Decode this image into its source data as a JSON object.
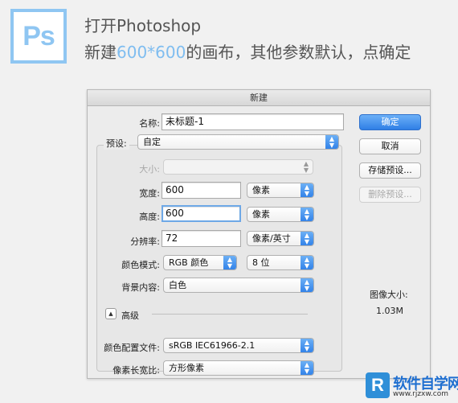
{
  "header": {
    "logo_text": "Ps",
    "line1": "打开Photoshop",
    "line2_prefix": "新建",
    "line2_highlight": "600*600",
    "line2_suffix": "的画布，其他参数默认，点确定"
  },
  "dialog": {
    "title": "新建",
    "name_label": "名称:",
    "name_value": "未标题-1",
    "preset_label": "预设:",
    "preset_value": "自定",
    "size_label": "大小:",
    "size_value": "",
    "width_label": "宽度:",
    "width_value": "600",
    "width_unit": "像素",
    "height_label": "高度:",
    "height_value": "600",
    "height_unit": "像素",
    "resolution_label": "分辨率:",
    "resolution_value": "72",
    "resolution_unit": "像素/英寸",
    "color_mode_label": "颜色模式:",
    "color_mode_value": "RGB 颜色",
    "bit_depth_value": "8 位",
    "background_label": "背景内容:",
    "background_value": "白色",
    "advanced_label": "高级",
    "color_profile_label": "颜色配置文件:",
    "color_profile_value": "sRGB IEC61966-2.1",
    "pixel_aspect_label": "像素长宽比:",
    "pixel_aspect_value": "方形像素",
    "buttons": {
      "ok": "确定",
      "cancel": "取消",
      "save_preset": "存储预设...",
      "delete_preset": "删除预设..."
    },
    "image_size_label": "图像大小:",
    "image_size_value": "1.03M"
  },
  "watermark": {
    "logo_text": "R",
    "name": "软件自学网",
    "url": "www.rjzxw.com"
  },
  "colors": {
    "accent": "#7fbdf0",
    "primary_button": "#2f7fe6"
  }
}
